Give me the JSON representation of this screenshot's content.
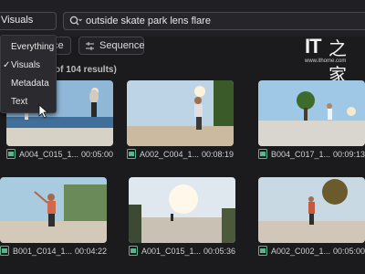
{
  "search": {
    "scope_value": "Visuals",
    "query": "outside skate park lens flare"
  },
  "menu": {
    "items": [
      {
        "label": "Everything",
        "checked": false
      },
      {
        "label": "Visuals",
        "checked": true
      },
      {
        "label": "Metadata",
        "checked": false
      },
      {
        "label": "Text",
        "checked": false
      }
    ],
    "check_glyph": "✓"
  },
  "filters": {
    "chip_a_label": "ce",
    "sequence_label": "Sequence"
  },
  "results_text": "of 104 results)",
  "watermark": {
    "logo_it": "IT",
    "logo_zh": "之家",
    "url": "www.ithome.com"
  },
  "clips": [
    {
      "name": "A004_C015_1...",
      "duration": "00:05:00"
    },
    {
      "name": "A002_C004_1...",
      "duration": "00:08:19"
    },
    {
      "name": "B004_C017_1...",
      "duration": "00:09:13"
    },
    {
      "name": "B001_C014_1...",
      "duration": "00:04:22"
    },
    {
      "name": "A001_C015_1...",
      "duration": "00:05:36"
    },
    {
      "name": "A002_C002_1...",
      "duration": "00:05:00"
    }
  ],
  "icons": {
    "search": "search-icon",
    "sequence": "sequence-icon",
    "clip": "video-clip-icon",
    "cursor": "mouse-cursor-icon"
  },
  "colors": {
    "background": "#1b1b1e",
    "menu_bg": "#2b2b2f",
    "clip_icon": "#5fb38a"
  }
}
